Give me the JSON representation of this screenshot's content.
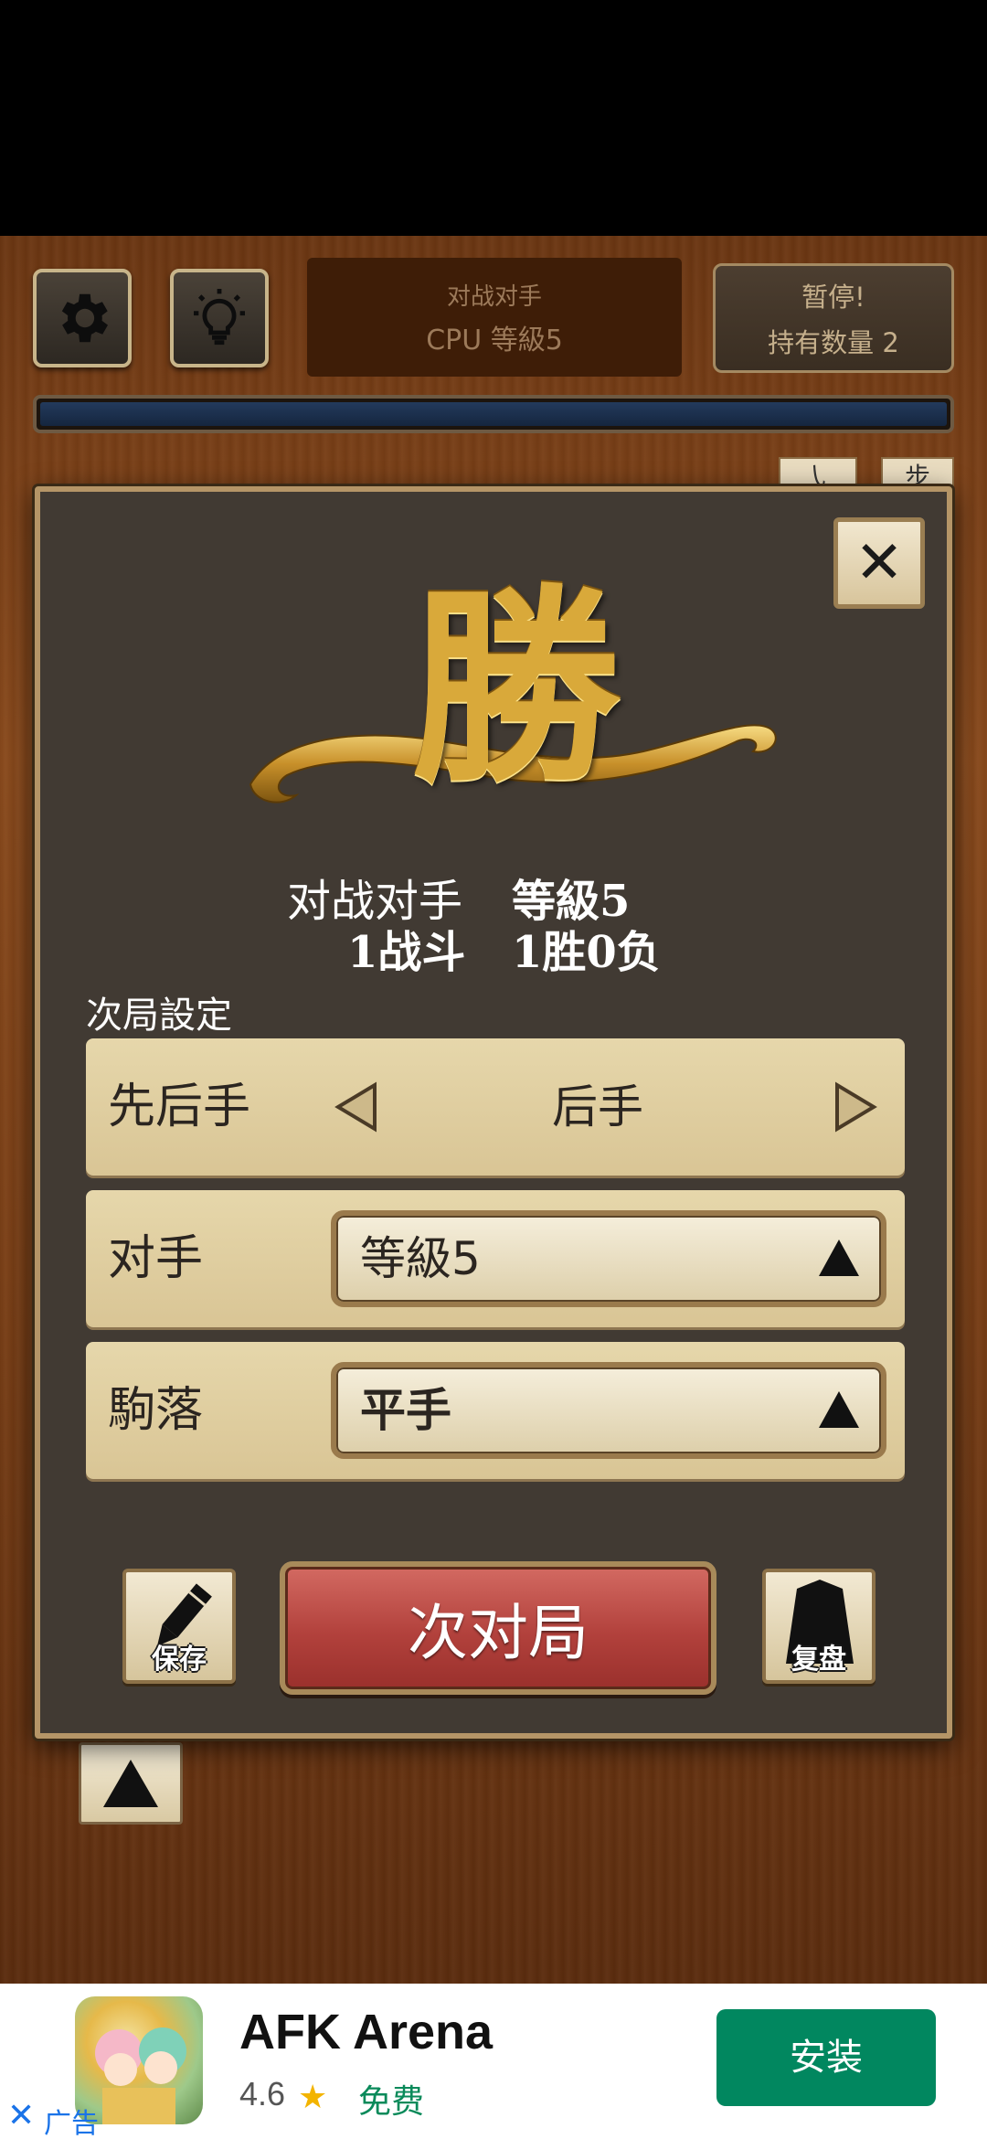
{
  "topbar": {
    "opponent_caption": "对战对手",
    "opponent_value": "CPU 等級5",
    "pause_line1": "暂停!",
    "pause_line2": "持有数量 2",
    "progress": 1.0
  },
  "background_tiles": [
    "㇂",
    "步"
  ],
  "modal": {
    "result_char": "勝",
    "opponent_label": "对战对手",
    "opponent_level": "等級5",
    "battles": "1战斗",
    "record": "1胜0负",
    "next_settings_label": "次局設定",
    "rows": {
      "turn": {
        "label": "先后手",
        "value": "后手"
      },
      "opponent": {
        "label": "对手",
        "value": "等級5"
      },
      "handicap": {
        "label": "駒落",
        "value": "平手"
      }
    },
    "save_label": "保存",
    "next_game_label": "次对局",
    "replay_label": "复盘"
  },
  "ad": {
    "title": "AFK Arena",
    "rating": "4.6",
    "price": "免费",
    "install_label": "安装",
    "close_glyph": "✕",
    "ad_tag": "广告"
  },
  "colors": {
    "accent_gold": "#d9a93a",
    "modal_bg": "#413a33",
    "next_button_red": "#b2413c",
    "install_green": "#01875f"
  },
  "icons": {
    "settings": "gear-icon",
    "hint": "lightbulb-icon",
    "close": "close-icon",
    "save": "pencil-icon",
    "replay": "shogi-piece-icon"
  }
}
